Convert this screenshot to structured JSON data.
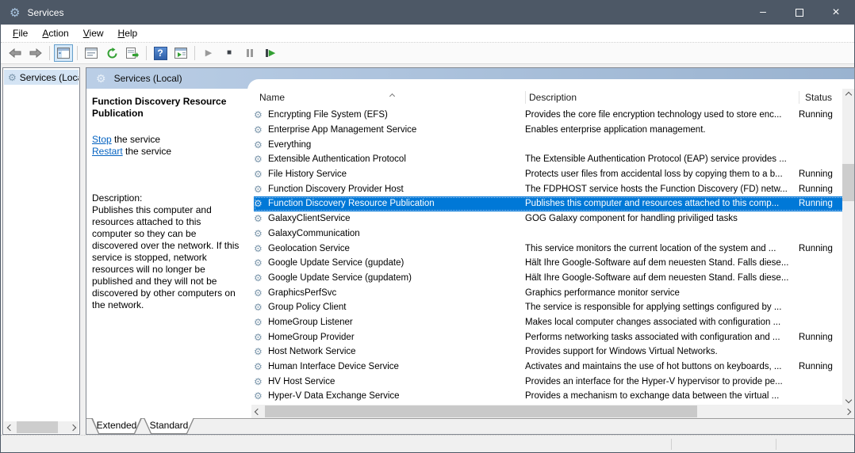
{
  "window": {
    "title": "Services",
    "controls": {
      "minimize": "–",
      "close": "×"
    }
  },
  "menu": {
    "items": [
      "File",
      "Action",
      "View",
      "Help"
    ]
  },
  "toolbar": {
    "buttons": [
      "back",
      "forward",
      "show-console-tree",
      "properties",
      "refresh",
      "export-list",
      "help",
      "show-action-pane",
      "start-service",
      "stop-service",
      "pause-service",
      "restart-service"
    ],
    "help_glyph": "?"
  },
  "glyphs": {
    "gear": "⚙",
    "play": "▶",
    "stop": "■"
  },
  "colors": {
    "titlebar": "#4d5866",
    "selection": "#0078d7",
    "band_left": "#bacee6",
    "band_right": "#9ab3d0",
    "link": "#0563c1",
    "running_green": "#33a033"
  },
  "tree": {
    "root_label": "Services (Local)"
  },
  "snapin": {
    "band_title": "Services (Local)",
    "info": {
      "service_title": "Function Discovery Resource Publication",
      "stop_link": "Stop",
      "stop_suffix": " the service",
      "restart_link": "Restart",
      "restart_suffix": " the service",
      "description_label": "Description:",
      "description": "Publishes this computer and resources attached to this computer so they can be discovered over the network.  If this service is stopped, network resources will no longer be published and they will not be discovered by other computers on the network."
    },
    "list": {
      "columns": {
        "name": "Name",
        "description": "Description",
        "status": "Status"
      },
      "sort_column": "Name",
      "sort_direction": "ascending",
      "rows": [
        {
          "name": "Encrypting File System (EFS)",
          "description": "Provides the core file encryption technology used to store enc...",
          "status": "Running",
          "selected": false
        },
        {
          "name": "Enterprise App Management Service",
          "description": "Enables enterprise application management.",
          "status": "",
          "selected": false
        },
        {
          "name": "Everything",
          "description": "",
          "status": "",
          "selected": false
        },
        {
          "name": "Extensible Authentication Protocol",
          "description": "The Extensible Authentication Protocol (EAP) service provides ...",
          "status": "",
          "selected": false
        },
        {
          "name": "File History Service",
          "description": "Protects user files from accidental loss by copying them to a b...",
          "status": "Running",
          "selected": false
        },
        {
          "name": "Function Discovery Provider Host",
          "description": "The FDPHOST service hosts the Function Discovery (FD) netw...",
          "status": "Running",
          "selected": false
        },
        {
          "name": "Function Discovery Resource Publication",
          "description": "Publishes this computer and resources attached to this comp...",
          "status": "Running",
          "selected": true
        },
        {
          "name": "GalaxyClientService",
          "description": "GOG Galaxy component for handling priviliged tasks",
          "status": "",
          "selected": false
        },
        {
          "name": "GalaxyCommunication",
          "description": "",
          "status": "",
          "selected": false
        },
        {
          "name": "Geolocation Service",
          "description": "This service monitors the current location of the system and ...",
          "status": "Running",
          "selected": false
        },
        {
          "name": "Google Update Service (gupdate)",
          "description": "Hält Ihre Google-Software auf dem neuesten Stand. Falls diese...",
          "status": "",
          "selected": false
        },
        {
          "name": "Google Update Service (gupdatem)",
          "description": "Hält Ihre Google-Software auf dem neuesten Stand. Falls diese...",
          "status": "",
          "selected": false
        },
        {
          "name": "GraphicsPerfSvc",
          "description": "Graphics performance monitor service",
          "status": "",
          "selected": false
        },
        {
          "name": "Group Policy Client",
          "description": "The service is responsible for applying settings configured by ...",
          "status": "",
          "selected": false
        },
        {
          "name": "HomeGroup Listener",
          "description": "Makes local computer changes associated with configuration ...",
          "status": "",
          "selected": false
        },
        {
          "name": "HomeGroup Provider",
          "description": "Performs networking tasks associated with configuration and ...",
          "status": "Running",
          "selected": false
        },
        {
          "name": "Host Network Service",
          "description": "Provides support for Windows Virtual Networks.",
          "status": "",
          "selected": false
        },
        {
          "name": "Human Interface Device Service",
          "description": "Activates and maintains the use of hot buttons on keyboards, ...",
          "status": "Running",
          "selected": false
        },
        {
          "name": "HV Host Service",
          "description": "Provides an interface for the Hyper-V hypervisor to provide pe...",
          "status": "",
          "selected": false
        },
        {
          "name": "Hyper-V Data Exchange Service",
          "description": "Provides a mechanism to exchange data between the virtual ...",
          "status": "",
          "selected": false
        }
      ]
    },
    "tabs": [
      {
        "label": "Extended",
        "active": true
      },
      {
        "label": "Standard",
        "active": false
      }
    ]
  }
}
